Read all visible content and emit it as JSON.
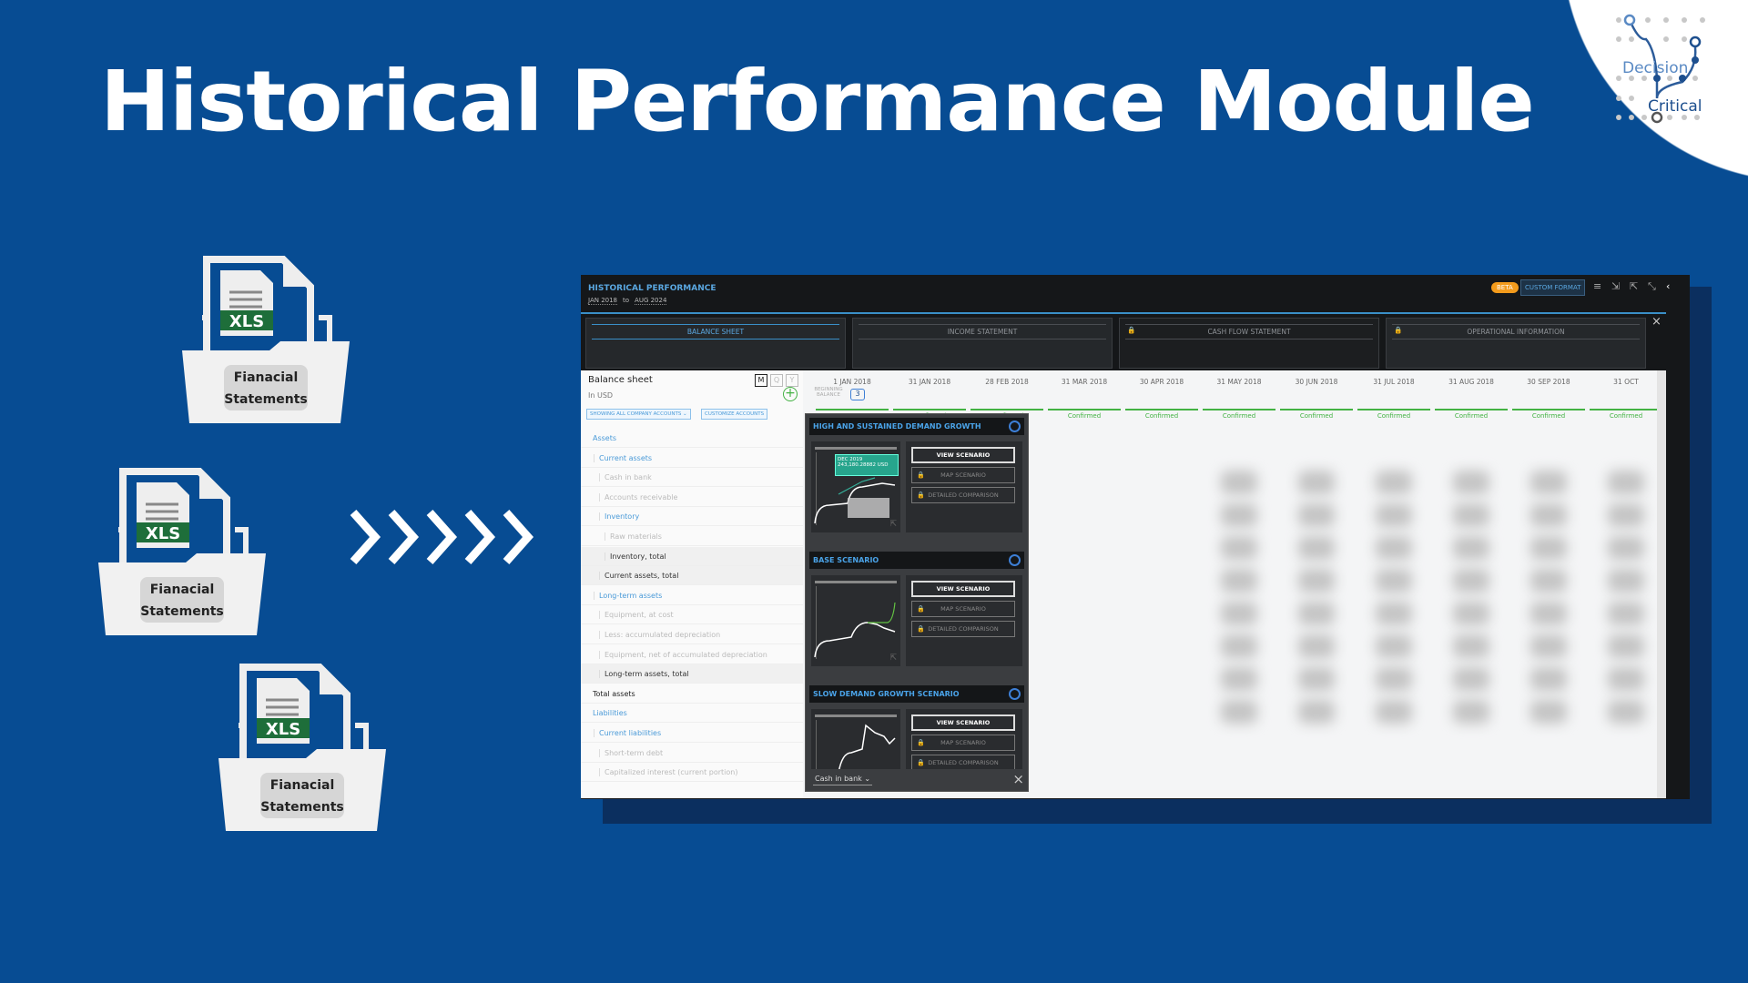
{
  "slide": {
    "title": "Historical Performance Module",
    "background": "#074c93"
  },
  "logo": {
    "line1": "Decision",
    "line2": "Critical"
  },
  "files": [
    {
      "badge": "XLS",
      "line1": "Fianacial",
      "line2": "Statements"
    },
    {
      "badge": "XLS",
      "line1": "Fianacial",
      "line2": "Statements"
    },
    {
      "badge": "XLS",
      "line1": "Fianacial",
      "line2": "Statements"
    }
  ],
  "app": {
    "title": "HISTORICAL PERFORMANCE",
    "date_from": "JAN 2018",
    "date_sep": "to",
    "date_to": "AUG 2024",
    "beta": "BETA",
    "custom_format": "CUSTOM FORMAT",
    "tabs": [
      {
        "label": "BALANCE SHEET",
        "active": true
      },
      {
        "label": "INCOME STATEMENT"
      },
      {
        "label": "CASH FLOW STATEMENT",
        "locked": true
      },
      {
        "label": "OPERATIONAL INFORMATION",
        "locked": true
      }
    ],
    "sheet": {
      "title": "Balance sheet",
      "unit": "In USD",
      "periods": [
        "M",
        "Q",
        "Y"
      ],
      "selected_period": "M",
      "show_accounts": "SHOWING ALL COMPANY ACCOUNTS ⌄",
      "customize": "CUSTOMIZE ACCOUNTS",
      "beginning_balance": "BEGINNING BALANCE",
      "scenario_count": "3"
    },
    "rows": [
      {
        "label": "Assets",
        "style": "blue",
        "indent": 0
      },
      {
        "label": "Current assets",
        "style": "blue",
        "indent": 1
      },
      {
        "label": "Cash in bank",
        "style": "gray",
        "indent": 2
      },
      {
        "label": "Accounts receivable",
        "style": "gray",
        "indent": 2
      },
      {
        "label": "Inventory",
        "style": "blue",
        "indent": 2
      },
      {
        "label": "Raw materials",
        "style": "gray",
        "indent": 3
      },
      {
        "label": "Inventory, total",
        "style": "dark",
        "indent": 3
      },
      {
        "label": "Current assets, total",
        "style": "dark",
        "indent": 2
      },
      {
        "label": "Long-term assets",
        "style": "blue",
        "indent": 1
      },
      {
        "label": "Equipment, at cost",
        "style": "gray",
        "indent": 2
      },
      {
        "label": "Less: accumulated depreciation",
        "style": "gray",
        "indent": 2
      },
      {
        "label": "Equipment, net of accumulated depreciation",
        "style": "gray",
        "indent": 2
      },
      {
        "label": "Long-term assets, total",
        "style": "dark",
        "indent": 2
      },
      {
        "label": "Total assets",
        "style": "top",
        "indent": 0
      },
      {
        "label": "Liabilities",
        "style": "blue",
        "indent": 0
      },
      {
        "label": "Current liabilities",
        "style": "blue",
        "indent": 1
      },
      {
        "label": "Short-term debt",
        "style": "gray",
        "indent": 2
      },
      {
        "label": "Capitalized interest (current portion)",
        "style": "gray",
        "indent": 2
      }
    ],
    "dates": [
      "1 JAN 2018",
      "31 JAN 2018",
      "28 FEB 2018",
      "31 MAR 2018",
      "30 APR 2018",
      "31 MAY 2018",
      "30 JUN 2018",
      "31 JUL 2018",
      "31 AUG 2018",
      "30 SEP 2018",
      "31 OCT"
    ],
    "status": "Confirmed",
    "popup": {
      "scenarios": [
        {
          "name": "HIGH AND SUSTAINED DEMAND GROWTH",
          "tooltip_date": "DEC 2019",
          "tooltip_value": "243,180.28882 USD"
        },
        {
          "name": "BASE SCENARIO"
        },
        {
          "name": "SLOW DEMAND GROWTH SCENARIO"
        }
      ],
      "view": "VIEW SCENARIO",
      "map": "MAP SCENARIO",
      "compare": "DETAILED COMPARISON",
      "account": "Cash in bank ⌄"
    }
  }
}
